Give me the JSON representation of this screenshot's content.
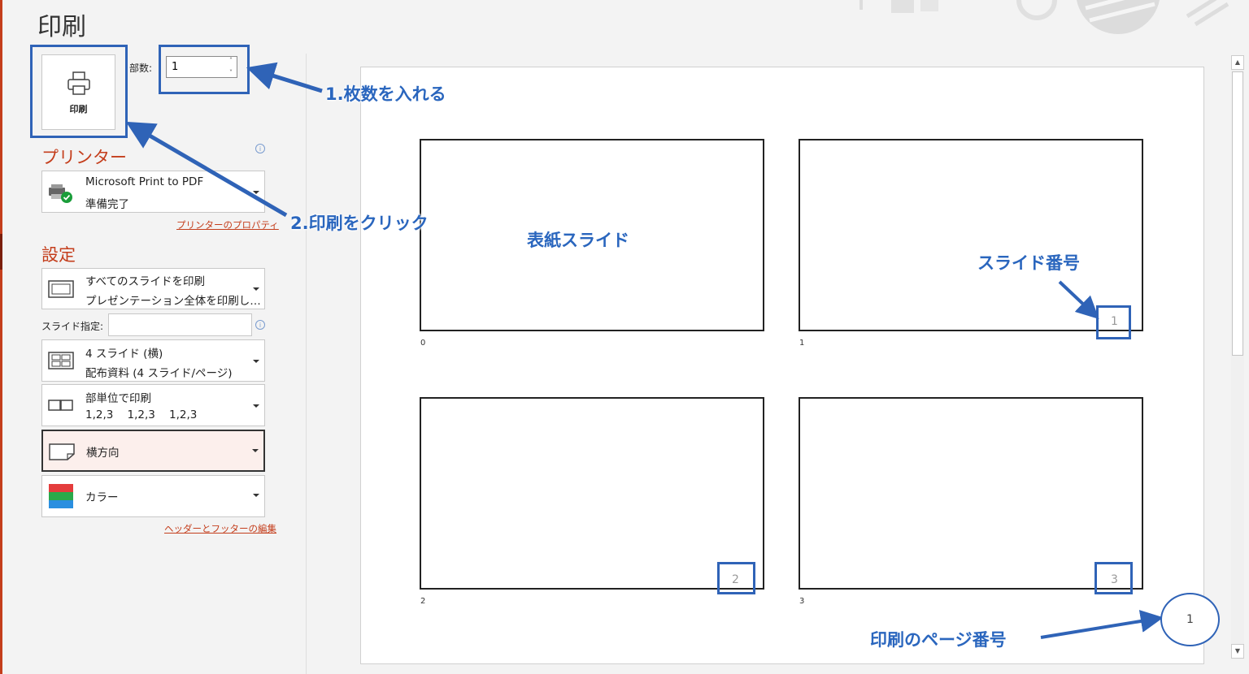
{
  "page": {
    "title": "印刷"
  },
  "print_button": {
    "label": "印刷"
  },
  "copies": {
    "label": "部数:",
    "value": "1"
  },
  "printer": {
    "heading": "プリンター",
    "name": "Microsoft Print to PDF",
    "status": "準備完了",
    "properties_link": "プリンターのプロパティ"
  },
  "settings": {
    "heading": "設定",
    "range": {
      "line1": "すべてのスライドを印刷",
      "line2": "プレゼンテーション全体を印刷し…"
    },
    "slide_spec_label": "スライド指定:",
    "slide_spec_value": "",
    "layout": {
      "line1": "4 スライド (横)",
      "line2": "配布資料 (4 スライド/ページ)"
    },
    "collate": {
      "line1": "部単位で印刷",
      "line2": "1,2,3    1,2,3    1,2,3"
    },
    "orientation": {
      "label": "横方向"
    },
    "color": {
      "label": "カラー"
    },
    "header_footer_link": "ヘッダーとフッターの編集"
  },
  "preview": {
    "slides": [
      {
        "number": "0",
        "corner": ""
      },
      {
        "number": "1",
        "corner": "1"
      },
      {
        "number": "2",
        "corner": "2"
      },
      {
        "number": "3",
        "corner": "3"
      }
    ],
    "page_number": "1"
  },
  "annotations": {
    "step1": "1.枚数を入れる",
    "step2": "2.印刷をクリック",
    "cover_slide": "表紙スライド",
    "slide_number": "スライド番号",
    "print_page_number": "印刷のページ番号"
  },
  "colors": {
    "accent": "#c43e1c",
    "annotation_blue": "#2f63b7"
  }
}
